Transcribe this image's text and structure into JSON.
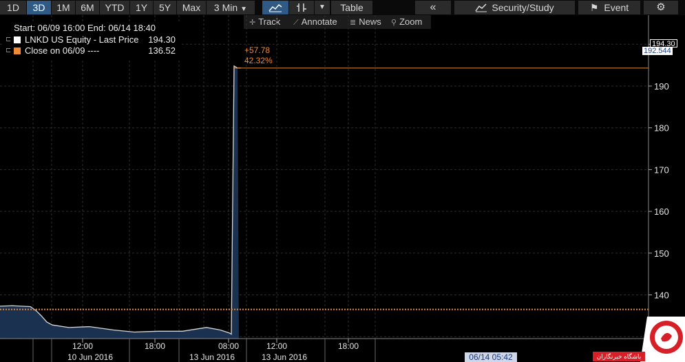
{
  "toolbar": {
    "ranges": [
      "1D",
      "3D",
      "1M",
      "6M",
      "YTD",
      "1Y",
      "5Y",
      "Max"
    ],
    "active_range": "3D",
    "interval_label": "3 Min",
    "table_label": "Table",
    "security_study_label": "Security/Study",
    "event_label": "Event"
  },
  "subbar": {
    "track_label": "Track",
    "annotate_label": "Annotate",
    "news_label": "News",
    "zoom_label": "Zoom"
  },
  "legend": {
    "range_text": "Start: 06/09 16:00 End: 06/14 18:40",
    "series1_label": "LNKD US Equity - Last Price",
    "series1_value": "194.30",
    "series2_label": "Close on 06/09 ----",
    "series2_value": "136.52"
  },
  "annotation": {
    "change": "+57.78",
    "change_pct": "42.32%"
  },
  "price_tags": {
    "last": "194.30",
    "crosshair": "192.544"
  },
  "cursor_time": "06/14 05:42",
  "watermark_text": "باشگاه خبرنگاران",
  "colors": {
    "line": "#d9d9d9",
    "area_fill": "#1b3553",
    "reference": "#f08a34",
    "grid": "#2e2e2e",
    "active_button": "#2f5a86"
  },
  "chart_data": {
    "type": "area",
    "ylim": [
      125,
      202
    ],
    "yticks": [
      130,
      140,
      150,
      160,
      170,
      180,
      190,
      200
    ],
    "x_tick_labels": [
      {
        "time": "12:00",
        "date": "10 Jun 2016"
      },
      {
        "time": "18:00",
        "date": ""
      },
      {
        "time": "08:00",
        "date": "13 Jun 2016"
      },
      {
        "time": "12:00",
        "date": "13 Jun 2016"
      },
      {
        "time": "18:00",
        "date": ""
      }
    ],
    "reference_value": 136.52,
    "series": [
      {
        "name": "LNKD US Equity - Last Price",
        "x": [
          "06/09 16:00",
          "06/10 08:00",
          "06/10 09:00",
          "06/10 09:30",
          "06/10 10:00",
          "06/10 10:30",
          "06/10 11:00",
          "06/10 12:00",
          "06/10 13:00",
          "06/10 14:00",
          "06/10 15:00",
          "06/10 16:00",
          "06/10 17:00",
          "06/10 18:00",
          "06/10 19:00",
          "06/13 07:00",
          "06/13 07:30",
          "06/13 08:00",
          "06/13 08:10",
          "06/13 08:20",
          "06/13 08:30",
          "06/13 08:40",
          "06/13 09:00",
          "06/13 10:00",
          "06/13 12:00",
          "06/14 18:40"
        ],
        "values": [
          137.3,
          137.4,
          137.2,
          136.3,
          135.0,
          133.5,
          132.8,
          132.2,
          132.4,
          131.6,
          131.1,
          131.2,
          131.3,
          131.3,
          131.3,
          132.2,
          131.6,
          130.9,
          130.6,
          194.8,
          194.3,
          194.3,
          194.3,
          194.3,
          194.3,
          194.3
        ]
      }
    ]
  }
}
